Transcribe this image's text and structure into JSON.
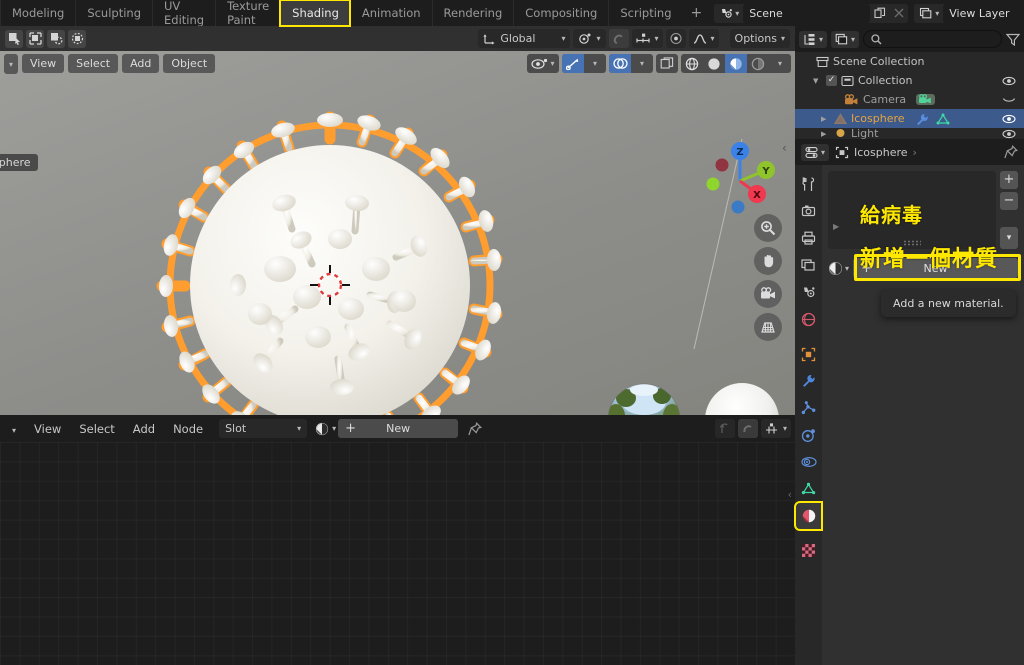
{
  "topbar": {
    "workspace_tabs": [
      {
        "label": "Modeling",
        "active": false
      },
      {
        "label": "Sculpting",
        "active": false
      },
      {
        "label": "UV Editing",
        "active": false
      },
      {
        "label": "Texture Paint",
        "active": false
      },
      {
        "label": "Shading",
        "active": true,
        "highlighted": true
      },
      {
        "label": "Animation",
        "active": false
      },
      {
        "label": "Rendering",
        "active": false
      },
      {
        "label": "Compositing",
        "active": false
      },
      {
        "label": "Scripting",
        "active": false
      }
    ],
    "add_workspace_label": "+",
    "scene_name": "Scene",
    "view_layer_name": "View Layer",
    "scene_icon": "scene-icon",
    "view_layer_icon": "view-layer-icon",
    "copy_icon": "new-copy-icon",
    "delete_icon": "x-close-icon"
  },
  "tool_header": {
    "select_mode_icons": [
      "tweak-select-icon",
      "box-select-icon",
      "circle-select-icon",
      "lasso-select-icon"
    ],
    "transform_orientation": "Global",
    "transform_pivot_icon": "pivot-point-icon",
    "snap_icon": "magnet-icon",
    "snap_to_icon": "snap-increment-icon",
    "proportional_edit_icon": "proportional-edit-icon",
    "falloff_icon": "smooth-falloff-icon",
    "options_label": "Options"
  },
  "viewport": {
    "menus": [
      "View",
      "Select",
      "Add",
      "Object"
    ],
    "editor_type_icon": "editor-type-icon",
    "object_name_label": "Icosphere",
    "visibility_icon": "object-visibility-icon",
    "gizmo_icon": "gizmo-icon",
    "overlays_icon": "overlays-icon",
    "xray_icon": "toggle-xray-icon",
    "shading_modes": [
      "wireframe-shading",
      "solid-shading",
      "material-preview-shading",
      "rendered-shading"
    ],
    "active_shading_mode": "material-preview-shading",
    "gizmo_axes": [
      {
        "label": "Z",
        "color": "#3b82e8"
      },
      {
        "label": "Y",
        "color": "#8fc42c"
      },
      {
        "label": "X",
        "color": "#f0384f"
      }
    ],
    "nav_buttons": [
      "zoom-icon",
      "pan-hand-icon",
      "camera-view-icon",
      "toggle-orthographic-icon"
    ],
    "model_name": "coronavirus-mesh",
    "selection_outline_color": "#ff9d2e",
    "preview_spheres": [
      "hdri-reflective-sphere",
      "diffuse-white-sphere"
    ]
  },
  "shader_editor": {
    "menus": [
      "View",
      "Select",
      "Add",
      "Node"
    ],
    "editor_type_icon": "shader-editor-icon",
    "slot_label": "Slot",
    "material_browse_icon": "material-browse-icon",
    "new_label": "New",
    "plus_label": "+",
    "pin_icon": "pin-icon",
    "parent_node_icon": "parent-node-icon",
    "snap_node_icon": "node-snap-icon",
    "snap_target_icon": "node-snap-target-icon"
  },
  "outliner": {
    "display_mode_icon": "outliner-display-mode-icon",
    "filter_id_icon": "filter-id-icon",
    "search_placeholder": "",
    "search_icon": "search-icon",
    "filter_icon": "funnel-filter-icon",
    "rows": [
      {
        "label": "Scene Collection",
        "icon": "scene-collection-icon",
        "indent": 0,
        "selected": false,
        "has_eye": false,
        "has_checkbox": false,
        "has_triangle": false
      },
      {
        "label": "Collection",
        "icon": "collection-icon",
        "indent": 1,
        "selected": false,
        "has_eye": true,
        "has_checkbox": true,
        "has_triangle": true
      },
      {
        "label": "Camera",
        "icon": "camera-data-icon",
        "indent": 2,
        "selected": false,
        "has_eye": true,
        "has_checkbox": false,
        "has_triangle": false,
        "extra_icon": "camera-object-data-icon"
      },
      {
        "label": "Icosphere",
        "icon": "mesh-object-icon",
        "indent": 2,
        "selected": true,
        "has_eye": true,
        "has_checkbox": false,
        "has_triangle": true,
        "extra_icon": "modifier-wrench-icon",
        "extra_icon2": "mesh-data-icon"
      },
      {
        "label": "Light",
        "icon": "light-object-icon",
        "indent": 2,
        "selected": false,
        "has_eye": true,
        "has_checkbox": false,
        "has_triangle": true
      }
    ]
  },
  "properties": {
    "breadcrumb_icon": "object-breadcrumb-icon",
    "breadcrumb_label": "Icosphere",
    "breadcrumb_arrow": "›",
    "editor_type_icon": "properties-editor-icon",
    "pin_icon": "pin-id-icon",
    "tabs": [
      {
        "name": "tool-tab",
        "icon": "tool-screwdriver-wrench-icon",
        "active": false
      },
      {
        "name": "render-tab",
        "icon": "render-camera-back-icon",
        "active": false
      },
      {
        "name": "output-tab",
        "icon": "output-printer-icon",
        "active": false
      },
      {
        "name": "view-layer-tab",
        "icon": "view-layer-images-icon",
        "active": false
      },
      {
        "name": "scene-tab",
        "icon": "scene-cone-icon",
        "active": false
      },
      {
        "name": "world-tab",
        "icon": "world-globe-icon",
        "active": false
      },
      {
        "name": "object-tab",
        "icon": "object-square-icon",
        "active": false
      },
      {
        "name": "modifier-tab",
        "icon": "modifier-wrench-icon",
        "active": false
      },
      {
        "name": "particles-tab",
        "icon": "particles-icon",
        "active": false
      },
      {
        "name": "physics-tab",
        "icon": "physics-orbit-icon",
        "active": false
      },
      {
        "name": "constraints-tab",
        "icon": "object-constraints-icon",
        "active": false
      },
      {
        "name": "data-tab",
        "icon": "mesh-data-triangle-icon",
        "active": false
      },
      {
        "name": "material-tab",
        "icon": "material-sphere-icon",
        "active": true,
        "highlighted": true
      },
      {
        "name": "texture-tab",
        "icon": "texture-checker-icon",
        "active": false
      }
    ],
    "material_slot_add_label": "+",
    "material_slot_remove_label": "−",
    "material_slot_menu_icon": "chevron-down-icon",
    "material_browse_icon": "material-browse-sphere-icon",
    "new_material_label": "New",
    "new_material_plus": "+",
    "tooltip_text": "Add a new material.",
    "annotations": [
      {
        "text": "給病毒",
        "color": "#ffe800"
      },
      {
        "text": "新增一個材質",
        "color": "#ffe800"
      }
    ]
  },
  "colors": {
    "highlight": "#ffe800",
    "selection_blue": "#3c5a8c",
    "accent_blue": "#4772b3",
    "outline_orange": "#ff9d2e",
    "bg_dark": "#1d1d1d",
    "bg_panel": "#303030",
    "bg_outliner": "#282828"
  }
}
